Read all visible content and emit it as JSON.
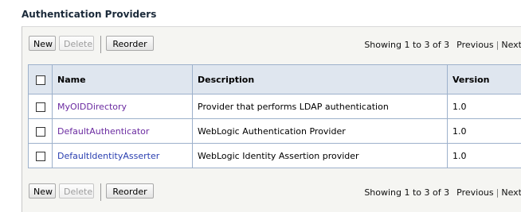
{
  "section": {
    "title": "Authentication Providers"
  },
  "toolbar_top": {
    "new_label": "New",
    "delete_label": "Delete",
    "reorder_label": "Reorder",
    "showing": "Showing 1 to 3 of 3",
    "previous": "Previous",
    "separator": "|",
    "next": "Next"
  },
  "toolbar_bottom": {
    "new_label": "New",
    "delete_label": "Delete",
    "reorder_label": "Reorder",
    "showing": "Showing 1 to 3 of 3",
    "previous": "Previous",
    "separator": "|",
    "next": "Next"
  },
  "table": {
    "headers": {
      "name": "Name",
      "description": "Description",
      "version": "Version"
    },
    "rows": [
      {
        "name": "MyOIDDirectory",
        "description": "Provider that performs LDAP authentication",
        "version": "1.0"
      },
      {
        "name": "DefaultAuthenticator",
        "description": "WebLogic Authentication Provider",
        "version": "1.0"
      },
      {
        "name": "DefaultIdentityAsserter",
        "description": "WebLogic Identity Assertion provider",
        "version": "1.0"
      }
    ]
  },
  "colors": {
    "header_bg": "#dfe6ef",
    "grid_border": "#9db1cb",
    "link_purple": "#6a2aa0",
    "link_blue": "#2a3fb0"
  }
}
